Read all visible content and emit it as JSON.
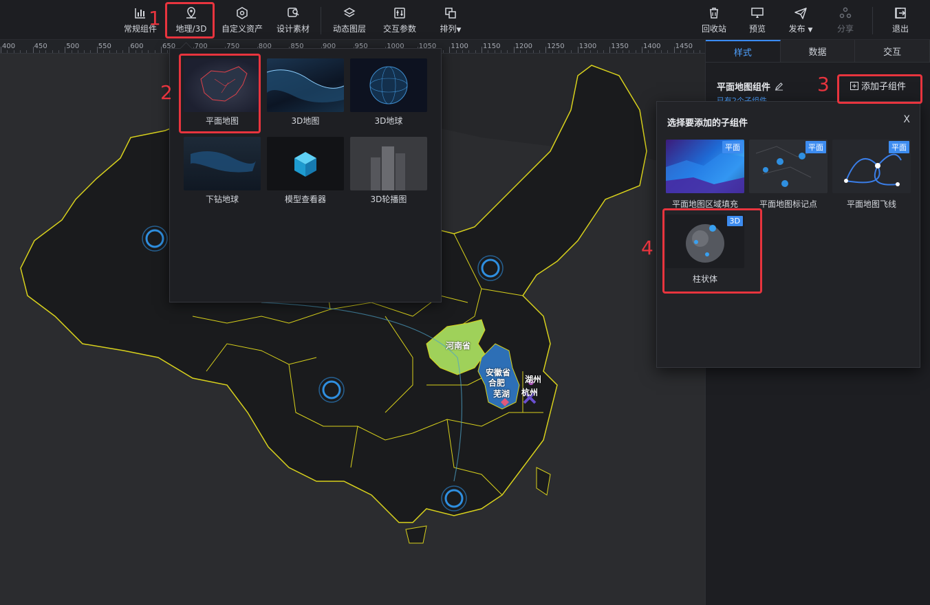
{
  "toolbar": {
    "left_tools": [
      {
        "label": "常规组件",
        "icon": "bar-chart-icon"
      },
      {
        "label": "地理/3D",
        "icon": "map-pin-icon"
      },
      {
        "label": "自定义资产",
        "icon": "hexagon-icon"
      },
      {
        "label": "设计素材",
        "icon": "image-search-icon"
      },
      {
        "label": "动态图层",
        "icon": "layers-icon"
      },
      {
        "label": "交互参数",
        "icon": "sliders-icon"
      },
      {
        "label": "排列",
        "icon": "arrange-icon",
        "has_dropdown": true
      }
    ],
    "right_tools": [
      {
        "label": "回收站",
        "icon": "trash-icon"
      },
      {
        "label": "预览",
        "icon": "preview-icon"
      },
      {
        "label": "发布",
        "icon": "send-icon",
        "has_dropdown": true
      },
      {
        "label": "分享",
        "icon": "share-icon",
        "disabled": true
      },
      {
        "label": "退出",
        "icon": "exit-icon"
      }
    ]
  },
  "ruler": {
    "ticks": [
      "400",
      "450",
      "500",
      "550",
      "600",
      "650",
      "700",
      "750",
      "800",
      "850",
      "900",
      "950",
      "1000",
      "1050",
      "1100",
      "1150",
      "1200",
      "1250",
      "1300",
      "1350",
      "1400",
      "1450"
    ]
  },
  "geo_dropdown": {
    "items": [
      {
        "label": "平面地图",
        "thumb": "flat-map"
      },
      {
        "label": "3D地图",
        "thumb": "3d-map"
      },
      {
        "label": "3D地球",
        "thumb": "3d-globe"
      },
      {
        "label": "下钻地球",
        "thumb": "drill-globe"
      },
      {
        "label": "模型查看器",
        "thumb": "model-viewer"
      },
      {
        "label": "3D轮播图",
        "thumb": "3d-carousel"
      }
    ]
  },
  "right_panel": {
    "tabs": [
      "样式",
      "数据",
      "交互"
    ],
    "active_tab": "样式",
    "component_title": "平面地图组件",
    "component_subtitle": "已有2个子组件",
    "add_child_label": "添加子组件"
  },
  "dialog": {
    "title": "选择要添加的子组件",
    "close_label": "X",
    "items": [
      {
        "label": "平面地图区域填充",
        "badge": "平面"
      },
      {
        "label": "平面地图标记点",
        "badge": "平面"
      },
      {
        "label": "平面地图飞线",
        "badge": "平面"
      },
      {
        "label": "柱状体",
        "badge": "3D"
      }
    ]
  },
  "map_labels": {
    "henan": "河南省",
    "anhui": "安徽省",
    "hefei": "合肥",
    "wuhu": "芜湖",
    "huzhou": "湖州",
    "hangzhou": "杭州"
  },
  "steps": [
    "1",
    "2",
    "3",
    "4"
  ],
  "colors": {
    "accent": "#3a8cff",
    "highlight": "#e8343e",
    "map_border": "#d9d21c",
    "henan_fill": "#9fd15a",
    "anhui_fill": "#2d6fb6"
  }
}
